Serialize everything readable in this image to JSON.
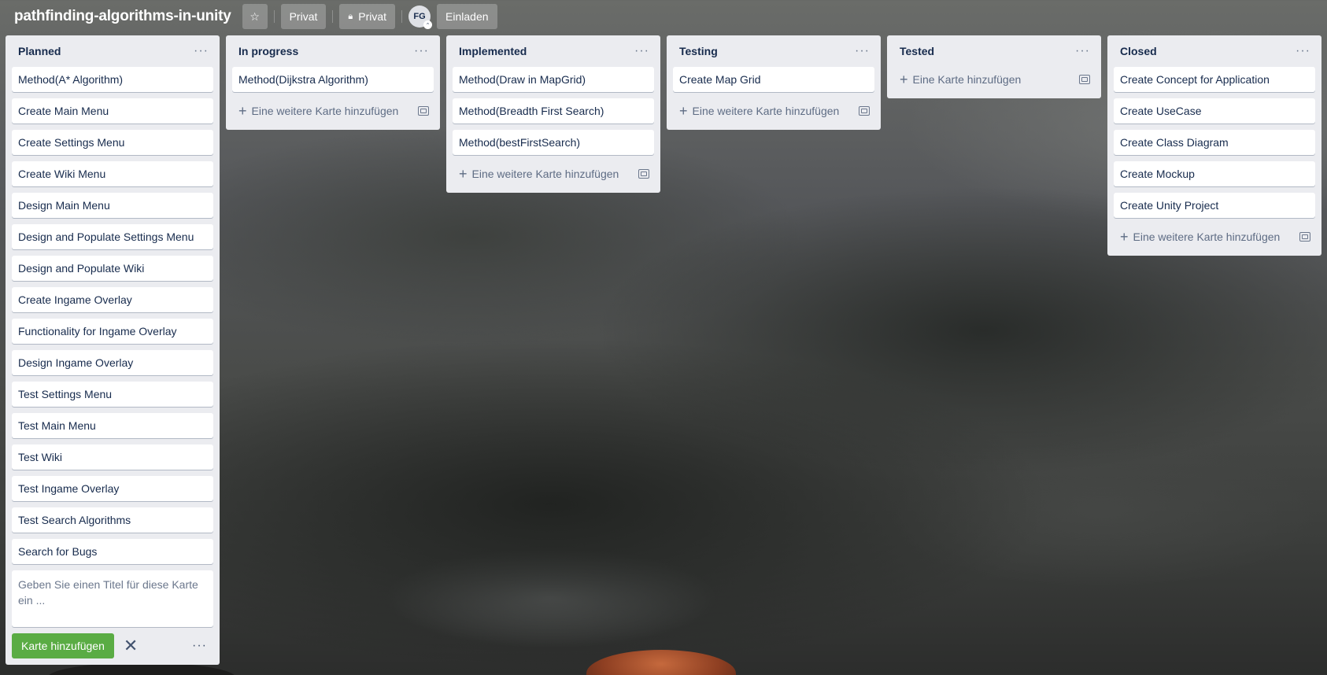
{
  "header": {
    "board_title": "pathfinding-algorithms-in-unity",
    "visibility_label": "Privat",
    "permission_label": "Privat",
    "member_initials": "FG",
    "invite_label": "Einladen"
  },
  "lists": [
    {
      "title": "Planned",
      "cards": [
        "Method(A* Algorithm)",
        "Create Main Menu",
        "Create Settings Menu",
        "Create Wiki Menu",
        "Design Main Menu",
        "Design and Populate Settings Menu",
        "Design and Populate Wiki",
        "Create Ingame Overlay",
        "Functionality for Ingame Overlay",
        "Design Ingame Overlay",
        "Test Settings Menu",
        "Test Main Menu",
        "Test Wiki",
        "Test Ingame Overlay",
        "Test Search Algorithms",
        "Search for Bugs"
      ]
    },
    {
      "title": "In progress",
      "cards": [
        "Method(Dijkstra Algorithm)"
      ],
      "add_label": "Eine weitere Karte hinzufügen"
    },
    {
      "title": "Implemented",
      "cards": [
        "Method(Draw in MapGrid)",
        "Method(Breadth First Search)",
        "Method(bestFirstSearch)"
      ],
      "add_label": "Eine weitere Karte hinzufügen"
    },
    {
      "title": "Testing",
      "cards": [
        "Create Map Grid"
      ],
      "add_label": "Eine weitere Karte hinzufügen"
    },
    {
      "title": "Tested",
      "cards": [],
      "add_label": "Eine Karte hinzufügen"
    },
    {
      "title": "Closed",
      "cards": [
        "Create Concept for Application",
        "Create UseCase",
        "Create Class Diagram",
        "Create Mockup",
        "Create Unity Project"
      ],
      "add_label": "Eine weitere Karte hinzufügen"
    }
  ],
  "composer": {
    "placeholder": "Geben Sie einen Titel für diese Karte ein ...",
    "submit_label": "Karte hinzufügen"
  }
}
